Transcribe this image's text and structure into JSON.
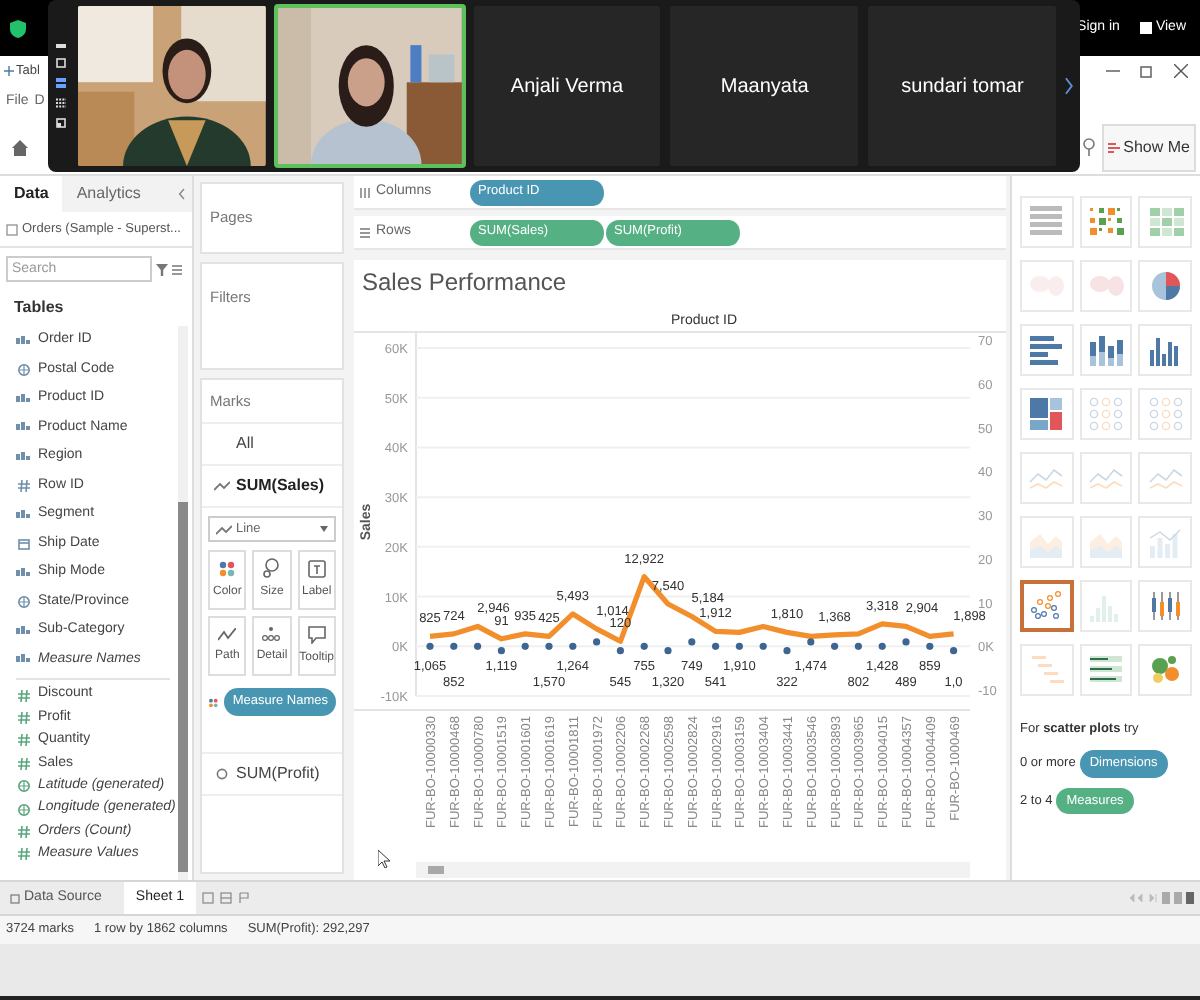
{
  "meeting": {
    "tiles": [
      {
        "kind": "video",
        "active": false
      },
      {
        "kind": "video",
        "active": true
      },
      {
        "kind": "name",
        "name": "Anjali Verma",
        "active": false
      },
      {
        "kind": "name",
        "name": "Maanyata",
        "active": false
      },
      {
        "kind": "name",
        "name": "sundari tomar",
        "active": false
      }
    ],
    "sign_in": "Sign in",
    "view": "View"
  },
  "window": {
    "title": "Tabl",
    "menu": [
      "File",
      "D"
    ]
  },
  "toolbar": {
    "show_me": "Show Me"
  },
  "data_pane": {
    "tabs": [
      {
        "label": "Data",
        "selected": true
      },
      {
        "label": "Analytics",
        "selected": false
      }
    ],
    "source": "Orders (Sample - Superst...",
    "search": {
      "placeholder": "Search"
    },
    "heading": "Tables",
    "fields": [
      {
        "name": "Order ID",
        "kind": "string",
        "measure": false,
        "virtual": false
      },
      {
        "name": "Postal Code",
        "kind": "geo",
        "measure": false,
        "virtual": false
      },
      {
        "name": "Product ID",
        "kind": "string",
        "measure": false,
        "virtual": false
      },
      {
        "name": "Product Name",
        "kind": "string",
        "measure": false,
        "virtual": false
      },
      {
        "name": "Region",
        "kind": "string",
        "measure": false,
        "virtual": false
      },
      {
        "name": "Row ID",
        "kind": "number",
        "measure": false,
        "virtual": false
      },
      {
        "name": "Segment",
        "kind": "string",
        "measure": false,
        "virtual": false
      },
      {
        "name": "Ship Date",
        "kind": "date",
        "measure": false,
        "virtual": false
      },
      {
        "name": "Ship Mode",
        "kind": "string",
        "measure": false,
        "virtual": false
      },
      {
        "name": "State/Province",
        "kind": "geo",
        "measure": false,
        "virtual": false
      },
      {
        "name": "Sub-Category",
        "kind": "string",
        "measure": false,
        "virtual": false
      },
      {
        "name": "Measure Names",
        "kind": "string",
        "measure": false,
        "virtual": true
      },
      {
        "name": "Discount",
        "kind": "number",
        "measure": true,
        "virtual": false
      },
      {
        "name": "Profit",
        "kind": "number",
        "measure": true,
        "virtual": false
      },
      {
        "name": "Quantity",
        "kind": "number",
        "measure": true,
        "virtual": false
      },
      {
        "name": "Sales",
        "kind": "number",
        "measure": true,
        "virtual": false
      },
      {
        "name": "Latitude (generated)",
        "kind": "geo",
        "measure": true,
        "virtual": true
      },
      {
        "name": "Longitude (generated)",
        "kind": "geo",
        "measure": true,
        "virtual": true
      },
      {
        "name": "Orders (Count)",
        "kind": "number",
        "measure": true,
        "virtual": true
      },
      {
        "name": "Measure Values",
        "kind": "number",
        "measure": true,
        "virtual": true
      }
    ]
  },
  "pages": {
    "title": "Pages"
  },
  "filters": {
    "title": "Filters"
  },
  "marks": {
    "title": "Marks",
    "cards": [
      {
        "label": "All",
        "kind": "all",
        "selected": false
      },
      {
        "label": "SUM(Sales)",
        "kind": "line",
        "selected": true
      },
      {
        "label": "SUM(Profit)",
        "kind": "circle",
        "selected": false
      }
    ],
    "mark_type": "Line",
    "buttons": [
      {
        "label": "Color",
        "kind": "color"
      },
      {
        "label": "Size",
        "kind": "size"
      },
      {
        "label": "Label",
        "kind": "label"
      },
      {
        "label": "Path",
        "kind": "path"
      },
      {
        "label": "Detail",
        "kind": "detail"
      },
      {
        "label": "Tooltip",
        "kind": "tooltip"
      }
    ],
    "encodings": [
      {
        "label": "Measure Names",
        "kind": "color"
      }
    ]
  },
  "shelves": [
    {
      "label": "Columns",
      "kind": "columns",
      "pills": [
        {
          "label": "Product ID",
          "kind": "dimension"
        }
      ]
    },
    {
      "label": "Rows",
      "kind": "rows",
      "pills": [
        {
          "label": "SUM(Sales)",
          "kind": "measure"
        },
        {
          "label": "SUM(Profit)",
          "kind": "measure"
        }
      ]
    }
  ],
  "view": {
    "title": "Sales Performance",
    "right_axis_ticks": [
      "70",
      "60",
      "50",
      "40",
      "30",
      "20",
      "10",
      "0K",
      "-10"
    ],
    "chart_data": {
      "type": "line",
      "xlabel": "Product ID",
      "ylabel": "Sales",
      "categories": [
        "FUR-BO-10000330",
        "FUR-BO-10000468",
        "FUR-BO-10000780",
        "FUR-BO-10001519",
        "FUR-BO-10001601",
        "FUR-BO-10001619",
        "FUR-BO-10001811",
        "FUR-BO-10001972",
        "FUR-BO-10002206",
        "FUR-BO-10002268",
        "FUR-BO-10002598",
        "FUR-BO-10002824",
        "FUR-BO-10002916",
        "FUR-BO-10003159",
        "FUR-BO-10003404",
        "FUR-BO-10003441",
        "FUR-BO-10003546",
        "FUR-BO-10003893",
        "FUR-BO-10003965",
        "FUR-BO-10004015",
        "FUR-BO-10004357",
        "FUR-BO-10004409",
        "FUR-BO-1000469"
      ],
      "grid": true,
      "series": [
        {
          "type": "line",
          "color": "#f28e2b",
          "values": [
            2000,
            2500,
            4000,
            1500,
            2500,
            2000,
            6500,
            3500,
            1000,
            14000,
            8500,
            6000,
            3000,
            2800,
            4000,
            2800,
            2000,
            2300,
            2500,
            4500,
            4000,
            2000,
            2500
          ]
        },
        {
          "type": "scatter",
          "color": "#3d6590",
          "values": [
            0,
            0,
            0,
            -1000,
            0,
            0,
            0,
            1000,
            -1000,
            0,
            -1000,
            1000,
            0,
            0,
            0,
            -1000,
            1000,
            0,
            0,
            0,
            1000,
            0,
            -1000
          ]
        }
      ],
      "ylim": [
        -10000,
        60000
      ],
      "yticks": [
        {
          "value": 60000,
          "label": "60K"
        },
        {
          "value": 50000,
          "label": "50K"
        },
        {
          "value": 40000,
          "label": "40K"
        },
        {
          "value": 30000,
          "label": "30K"
        },
        {
          "value": 20000,
          "label": "20K"
        },
        {
          "value": 10000,
          "label": "10K"
        },
        {
          "value": 0,
          "label": "0K"
        },
        {
          "value": -10000,
          "label": "-10K"
        }
      ],
      "annotations": [
        {
          "x": "FUR-BO-10000330",
          "y": 2000,
          "text": "825"
        },
        {
          "x": "FUR-BO-10000468",
          "y": 2500,
          "text": "724"
        },
        {
          "x": "FUR-BO-10000780",
          "y": 4000,
          "text": "2,946"
        },
        {
          "x": "FUR-BO-10001519",
          "y": 1500,
          "text": "91"
        },
        {
          "x": "FUR-BO-10001601",
          "y": 2500,
          "text": "935"
        },
        {
          "x": "FUR-BO-10001619",
          "y": 2000,
          "text": "425"
        },
        {
          "x": "FUR-BO-10001811",
          "y": 6500,
          "text": "5,493"
        },
        {
          "x": "FUR-BO-10001972",
          "y": 3500,
          "text": "1,014"
        },
        {
          "x": "FUR-BO-10002206",
          "y": 1000,
          "text": "120"
        },
        {
          "x": "FUR-BO-10002268",
          "y": 14000,
          "text": "12,922"
        },
        {
          "x": "FUR-BO-10002598",
          "y": 8500,
          "text": "7,540"
        },
        {
          "x": "FUR-BO-10002824",
          "y": 6000,
          "text": "5,184"
        },
        {
          "x": "FUR-BO-10002916",
          "y": 3000,
          "text": "1,912"
        },
        {
          "x": "FUR-BO-10003441",
          "y": 2800,
          "text": "1,810"
        },
        {
          "x": "FUR-BO-10003893",
          "y": 2300,
          "text": "1,368"
        },
        {
          "x": "FUR-BO-10004015",
          "y": 4500,
          "text": "3,318"
        },
        {
          "x": "FUR-BO-10004357",
          "y": 4000,
          "text": "2,904"
        },
        {
          "x": "FUR-BO-1000469",
          "y": 2500,
          "text": "1,898"
        },
        {
          "x": "FUR-BO-10000330",
          "y": 0,
          "text": "1,065"
        },
        {
          "x": "FUR-BO-10000468",
          "y": 0,
          "text": "852"
        },
        {
          "x": "FUR-BO-10001519",
          "y": -1000,
          "text": "1,119"
        },
        {
          "x": "FUR-BO-10001619",
          "y": 0,
          "text": "1,570"
        },
        {
          "x": "FUR-BO-10001811",
          "y": 0,
          "text": "1,264"
        },
        {
          "x": "FUR-BO-10002206",
          "y": -1000,
          "text": "545"
        },
        {
          "x": "FUR-BO-10002268",
          "y": 0,
          "text": "755"
        },
        {
          "x": "FUR-BO-10002598",
          "y": -1000,
          "text": "1,320"
        },
        {
          "x": "FUR-BO-10002824",
          "y": 1000,
          "text": "749"
        },
        {
          "x": "FUR-BO-10002916",
          "y": 0,
          "text": "541"
        },
        {
          "x": "FUR-BO-10003159",
          "y": 0,
          "text": "1,910"
        },
        {
          "x": "FUR-BO-10003441",
          "y": -1000,
          "text": "322"
        },
        {
          "x": "FUR-BO-10003546",
          "y": 1000,
          "text": "1,474"
        },
        {
          "x": "FUR-BO-10003965",
          "y": 0,
          "text": "802"
        },
        {
          "x": "FUR-BO-10004015",
          "y": 0,
          "text": "1,428"
        },
        {
          "x": "FUR-BO-10004357",
          "y": 1000,
          "text": "489"
        },
        {
          "x": "FUR-BO-10004409",
          "y": 0,
          "text": "859"
        },
        {
          "x": "FUR-BO-1000469",
          "y": -1000,
          "text": "1,0"
        }
      ]
    }
  },
  "show_me": {
    "charts": [
      {
        "kind": "table",
        "enabled": true,
        "selected": false
      },
      {
        "kind": "heatmap",
        "enabled": true,
        "selected": false
      },
      {
        "kind": "highlight",
        "enabled": true,
        "selected": false
      },
      {
        "kind": "symbol-map",
        "enabled": false,
        "selected": false
      },
      {
        "kind": "filled-map",
        "enabled": false,
        "selected": false
      },
      {
        "kind": "pie",
        "enabled": true,
        "selected": false
      },
      {
        "kind": "hbar",
        "enabled": true,
        "selected": false
      },
      {
        "kind": "stacked-bar",
        "enabled": true,
        "selected": false
      },
      {
        "kind": "side-bar",
        "enabled": true,
        "selected": false
      },
      {
        "kind": "treemap",
        "enabled": true,
        "selected": false
      },
      {
        "kind": "circle",
        "enabled": false,
        "selected": false
      },
      {
        "kind": "side-circle",
        "enabled": false,
        "selected": false
      },
      {
        "kind": "line",
        "enabled": false,
        "selected": false
      },
      {
        "kind": "line-discrete",
        "enabled": false,
        "selected": false
      },
      {
        "kind": "dual-line",
        "enabled": false,
        "selected": false
      },
      {
        "kind": "area",
        "enabled": false,
        "selected": false
      },
      {
        "kind": "area-discrete",
        "enabled": false,
        "selected": false
      },
      {
        "kind": "dual-combo",
        "enabled": false,
        "selected": false
      },
      {
        "kind": "scatter",
        "enabled": true,
        "selected": true
      },
      {
        "kind": "histogram",
        "enabled": false,
        "selected": false
      },
      {
        "kind": "box",
        "enabled": true,
        "selected": false
      },
      {
        "kind": "gantt",
        "enabled": false,
        "selected": false
      },
      {
        "kind": "bullet",
        "enabled": true,
        "selected": false
      },
      {
        "kind": "bubbles",
        "enabled": true,
        "selected": false
      }
    ],
    "hint": "For **scatter plots** try",
    "requirements": [
      {
        "text": "0 or more",
        "pill": "Dimensions",
        "kind": "dimension"
      },
      {
        "text": "2 to 4",
        "pill": "Measures",
        "kind": "measure"
      }
    ]
  },
  "sheet_tabs": {
    "data_source": "Data Source",
    "sheets": [
      {
        "label": "Sheet 1",
        "selected": true
      }
    ]
  },
  "status_bar": [
    "3724 marks",
    "1 row by 1862 columns",
    "SUM(Profit): 292,297"
  ]
}
